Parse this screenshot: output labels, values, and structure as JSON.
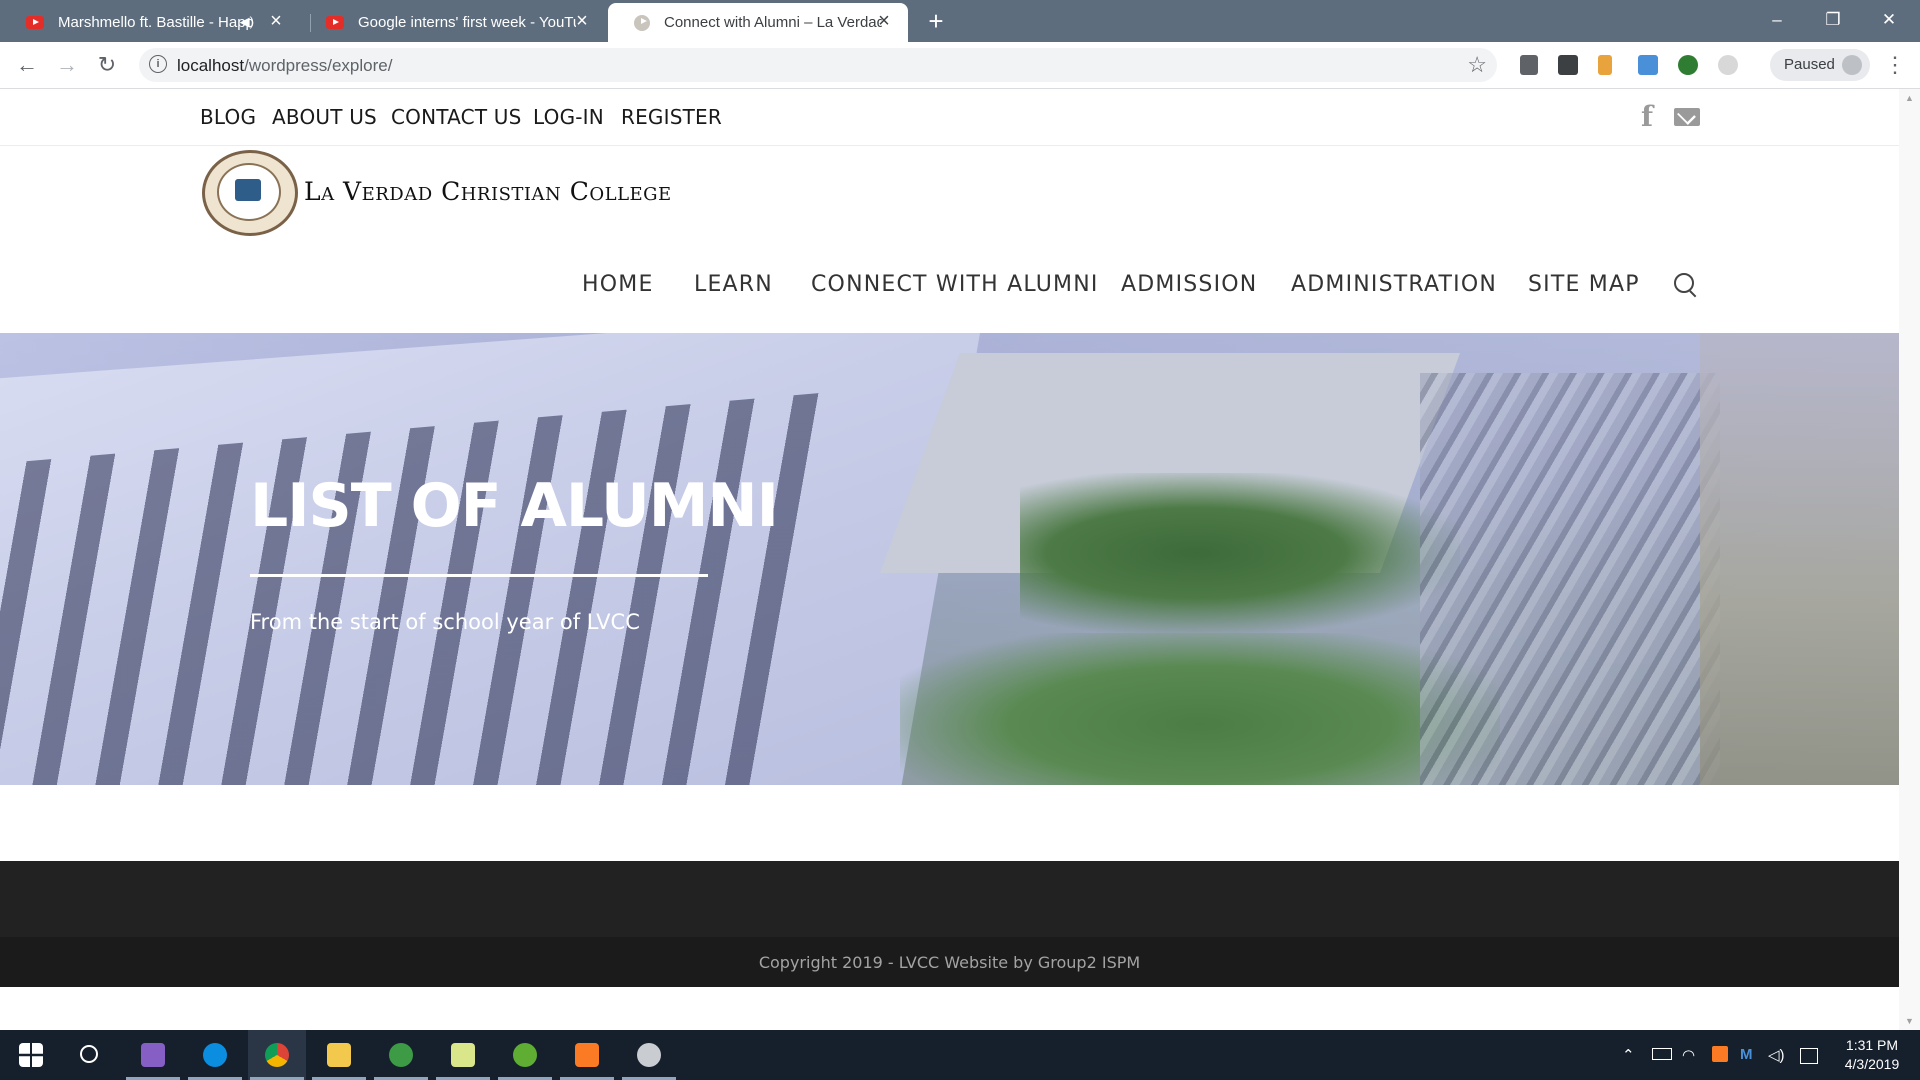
{
  "browser": {
    "tabs": [
      {
        "title": "Marshmello ft. Bastille - Happ",
        "favicon": "youtube-icon",
        "audio": true
      },
      {
        "title": "Google interns' first week - YouTu",
        "favicon": "youtube-icon",
        "audio": false
      },
      {
        "title": "Connect with Alumni – La Verdad",
        "favicon": "site-icon",
        "active": true
      }
    ],
    "url_host": "localhost",
    "url_path": "/wordpress/explore/",
    "profile_label": "Paused"
  },
  "site": {
    "top_nav": [
      "BLOG",
      "ABOUT US",
      "CONTACT US",
      "LOG-IN",
      "REGISTER"
    ],
    "logo_text": "La Verdad Christian College",
    "main_nav": [
      "HOME",
      "LEARN",
      "CONNECT WITH ALUMNI",
      "ADMISSION",
      "ADMINISTRATION",
      "SITE MAP"
    ],
    "hero": {
      "title": "LIST OF ALUMNI",
      "subtitle": "From the start of school year of LVCC"
    },
    "copyright": "Copyright 2019 - LVCC Website by Group2 ISPM"
  },
  "taskbar": {
    "time": "1:31 PM",
    "date": "4/3/2019"
  },
  "colors": {
    "tabstrip": "#5d6d7e",
    "footer": "#222222",
    "taskbar": "#16202c"
  }
}
